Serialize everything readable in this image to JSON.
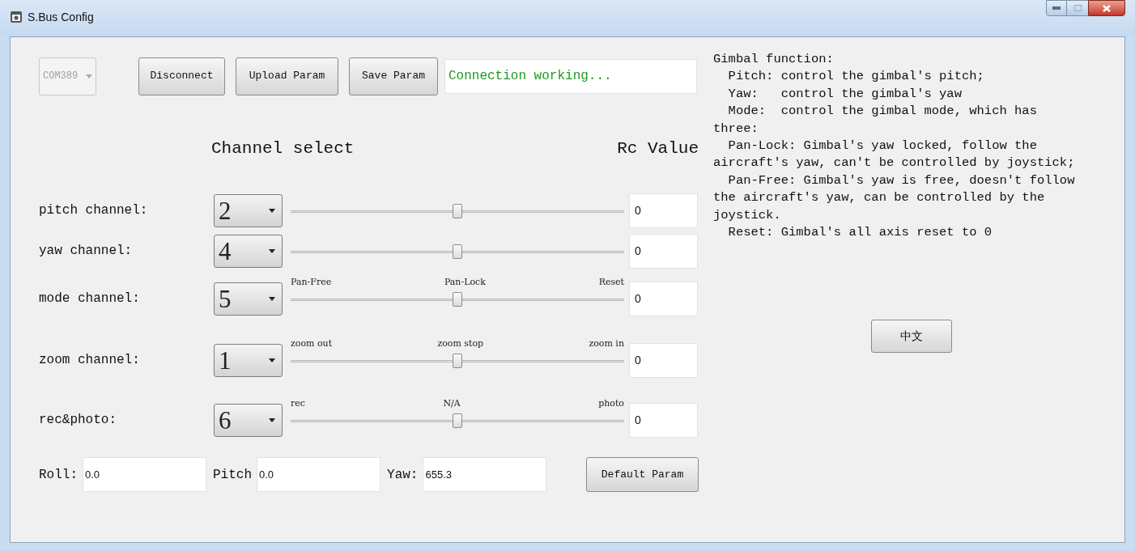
{
  "window": {
    "title": "S.Bus Config"
  },
  "port": {
    "value": "COM389",
    "disabled": true
  },
  "toolbar_buttons": [
    "Disconnect",
    "Upload Param",
    "Save Param"
  ],
  "status": {
    "text": "Connection working..."
  },
  "headings": {
    "channel_select": "Channel select",
    "rc_value": "Rc Value"
  },
  "channels": [
    {
      "label": "pitch channel:",
      "channel": "2",
      "level": 0.5,
      "value": "0"
    },
    {
      "label": "yaw channel:",
      "channel": "4",
      "level": 0.5,
      "value": "0"
    },
    {
      "label": "mode channel:",
      "channel": "5",
      "marks": [
        "Pan-Free",
        "Pan-Lock",
        "Reset"
      ],
      "level": 0.5,
      "value": "0"
    },
    {
      "label": "zoom channel:",
      "channel": "1",
      "marks": [
        "zoom out",
        "zoom stop",
        "zoom in"
      ],
      "level": 0.5,
      "value": "0"
    },
    {
      "label": "rec&photo:",
      "channel": "6",
      "marks": [
        "rec",
        "N/A",
        "photo"
      ],
      "level": 0.5,
      "value": "0"
    }
  ],
  "attitude": [
    {
      "label": "Roll:",
      "value": "0.0"
    },
    {
      "label": "Pitch",
      "value": "0.0"
    },
    {
      "label": "Yaw:",
      "value": "655.3"
    }
  ],
  "default_button": "Default Param",
  "help": {
    "text": "Gimbal function:\n  Pitch: control the gimbal's pitch;\n  Yaw:   control the gimbal's yaw\n  Mode:  control the gimbal mode, which has\nthree:\n  Pan-Lock: Gimbal's yaw locked, follow the\naircraft's yaw, can't be controlled by joystick;\n  Pan-Free: Gimbal's yaw is free, doesn't follow\nthe aircraft's yaw, can be controlled by the\njoystick.\n  Reset: Gimbal's all axis reset to 0"
  },
  "language_button": "中文"
}
